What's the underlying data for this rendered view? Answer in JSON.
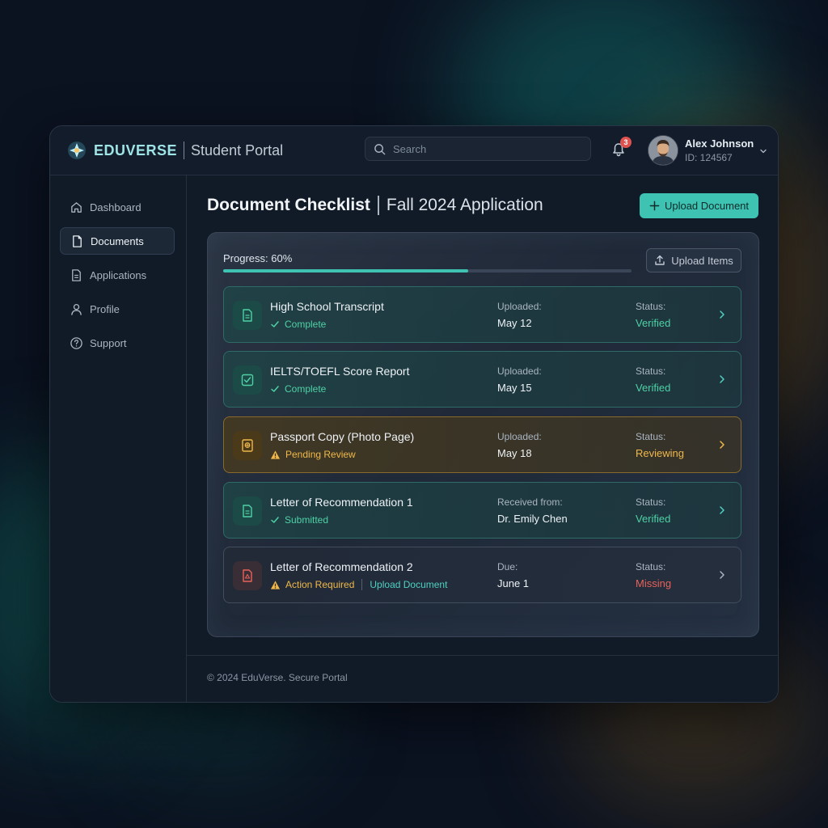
{
  "brand": {
    "name": "EDUVERSE",
    "subtitle": "Student Portal"
  },
  "search": {
    "placeholder": "Search"
  },
  "notifications": {
    "count": "3"
  },
  "user": {
    "name": "Alex Johnson",
    "id": "ID: 124567"
  },
  "sidebar": {
    "items": [
      {
        "label": "Dashboard",
        "icon": "home-icon"
      },
      {
        "label": "Documents",
        "icon": "document-icon",
        "active": true
      },
      {
        "label": "Applications",
        "icon": "file-text-icon"
      },
      {
        "label": "Profile",
        "icon": "user-icon"
      },
      {
        "label": "Support",
        "icon": "help-circle-icon"
      }
    ]
  },
  "page": {
    "title": "Document Checklist",
    "subtitle": "Fall 2024 Application",
    "upload_label": "Upload Document"
  },
  "progress": {
    "label": "Progress: 60%",
    "value": 0.6
  },
  "upload_items_label": "Upload Items",
  "documents": [
    {
      "title": "High School Transcript",
      "state": "Complete",
      "key1": "Uploaded:",
      "val1": "May 12",
      "key2": "Status:",
      "val2": "Verified"
    },
    {
      "title": "IELTS/TOEFL Score Report",
      "state": "Complete",
      "key1": "Uploaded:",
      "val1": "May 15",
      "key2": "Status:",
      "val2": "Verified"
    },
    {
      "title": "Passport Copy (Photo Page)",
      "state": "Pending Review",
      "key1": "Uploaded:",
      "val1": "May 18",
      "key2": "Status:",
      "val2": "Reviewing"
    },
    {
      "title": "Letter of Recommendation 1",
      "state": "Submitted",
      "key1": "Received from:",
      "val1": "Dr. Emily Chen",
      "key2": "Status:",
      "val2": "Verified"
    },
    {
      "title": "Letter of Recommendation 2",
      "state": "Action Required",
      "action": "Upload Document",
      "key1": "Due:",
      "val1": "June 1",
      "key2": "Status:",
      "val2": "Missing"
    }
  ],
  "footer": {
    "text": "© 2024 EduVerse. Secure Portal"
  },
  "colors": {
    "accent": "#3ec3b3",
    "verified": "#4fd1a5",
    "warning": "#f0b84a",
    "danger": "#e8625a",
    "background": "#0b1220"
  }
}
